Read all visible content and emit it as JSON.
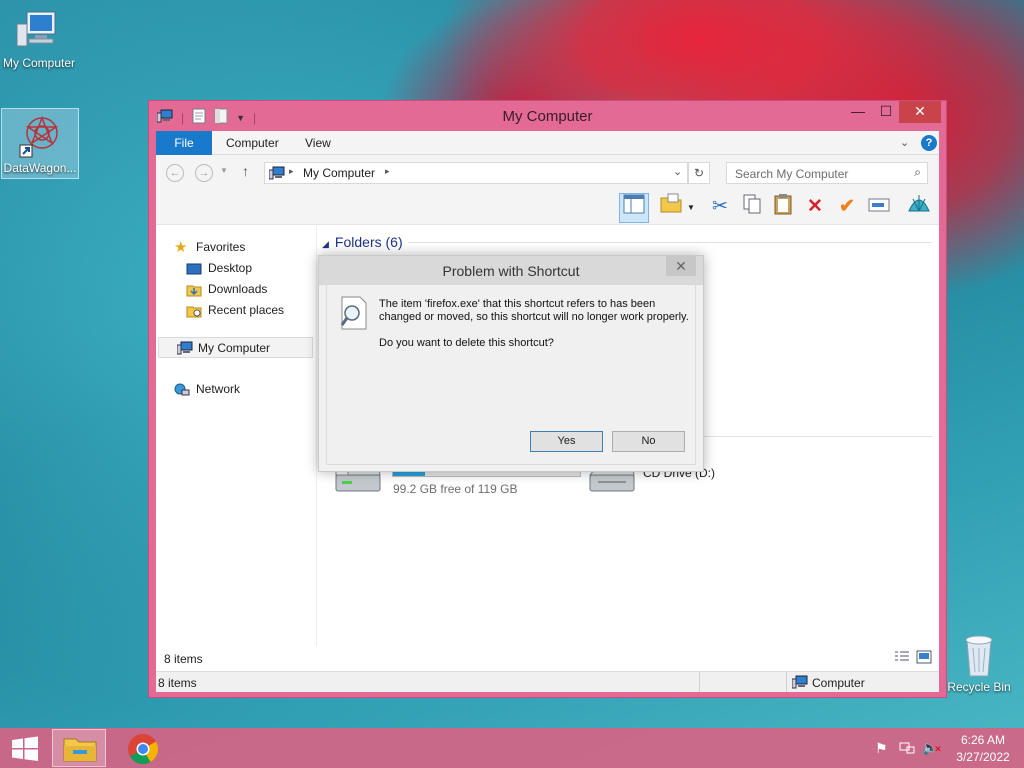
{
  "desktop": {
    "icons": [
      {
        "label": "My Computer"
      },
      {
        "label": "DataWagon..."
      },
      {
        "label": "Recycle Bin"
      }
    ]
  },
  "window": {
    "title": "My Computer",
    "ribbon_tabs": [
      {
        "label": "File"
      },
      {
        "label": "Computer"
      },
      {
        "label": "View"
      }
    ],
    "address": {
      "location": "My Computer"
    },
    "search": {
      "placeholder": "Search My Computer"
    },
    "nav": {
      "favorites": "Favorites",
      "desktop": "Desktop",
      "downloads": "Downloads",
      "recent": "Recent places",
      "mycomputer": "My Computer",
      "network": "Network"
    },
    "content": {
      "folders_header": "Folders (6)",
      "drive_c": {
        "free_text": "99.2 GB free of 119 GB",
        "used_fraction": 0.17
      },
      "drive_d": {
        "label": "CD Drive (D:)"
      }
    },
    "status": {
      "items": "8 items"
    },
    "status_bar": {
      "items": "8 items",
      "location": "Computer"
    }
  },
  "dialog": {
    "title": "Problem with Shortcut",
    "message_line1": "The item 'firefox.exe' that this shortcut refers to has been",
    "message_line2": "changed or moved, so this shortcut will no longer work properly.",
    "question": "Do you want to delete this shortcut?",
    "yes": "Yes",
    "no": "No"
  },
  "taskbar": {
    "time": "6:26 AM",
    "date": "3/27/2022"
  },
  "colors": {
    "accent": "#1979ca",
    "window_frame": "#e46a96",
    "taskbar": "#d66486",
    "close": "#c8434a"
  }
}
